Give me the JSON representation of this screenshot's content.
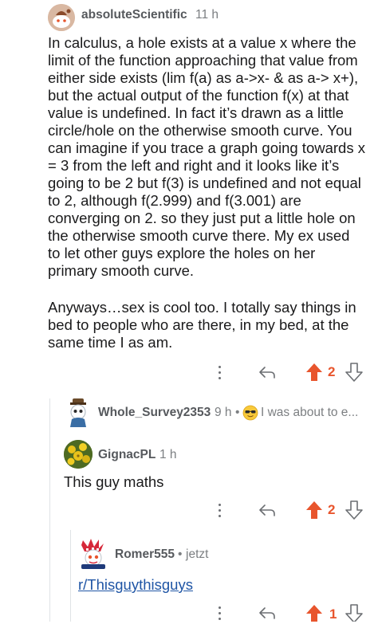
{
  "colors": {
    "upvote": "#e8552d",
    "meta": "#7c7f82",
    "username": "#56595d",
    "link": "#1f55a5",
    "thread_line": "#e0e3e6"
  },
  "comments": [
    {
      "username": "absoluteScientific",
      "time": "11 h",
      "avatar_icon": "snoo-avatar-icon",
      "body_paragraph_1": "In calculus, a hole exists at a value x where the limit of the function approaching that value from either side exists (lim f(a) as a->x- & as a-> x+), but the actual output of the function f(x) at that value is undefined. In fact it’s drawn as a little circle/hole on the otherwise smooth curve. You can imagine if you trace a graph going towards x = 3 from the left and right and it looks like it’s going to be 2 but f(3) is undefined and not equal to 2, although f(2.999) and f(3.001) are converging on 2. so they just put a little hole on the otherwise smooth curve there. My ex used to let other guys explore the holes on her primary smooth curve.",
      "body_paragraph_2": "Anyways…sex is cool too. I totally say things in bed to people who are there, in my bed, at the same time I as am.",
      "votes": "2"
    },
    {
      "username": "Whole_Survey2353",
      "time": "9 h",
      "separator": "•",
      "collapsed_preview": "I was about to e...",
      "preview_icon": "sunglasses-emoji-icon"
    },
    {
      "username": "GignacPL",
      "time": "1 h",
      "body": "This guy maths",
      "votes": "2"
    },
    {
      "username": "Romer555",
      "separator": "•",
      "time": "jetzt",
      "link_text": "r/Thisguythisguys",
      "votes": "1"
    }
  ]
}
